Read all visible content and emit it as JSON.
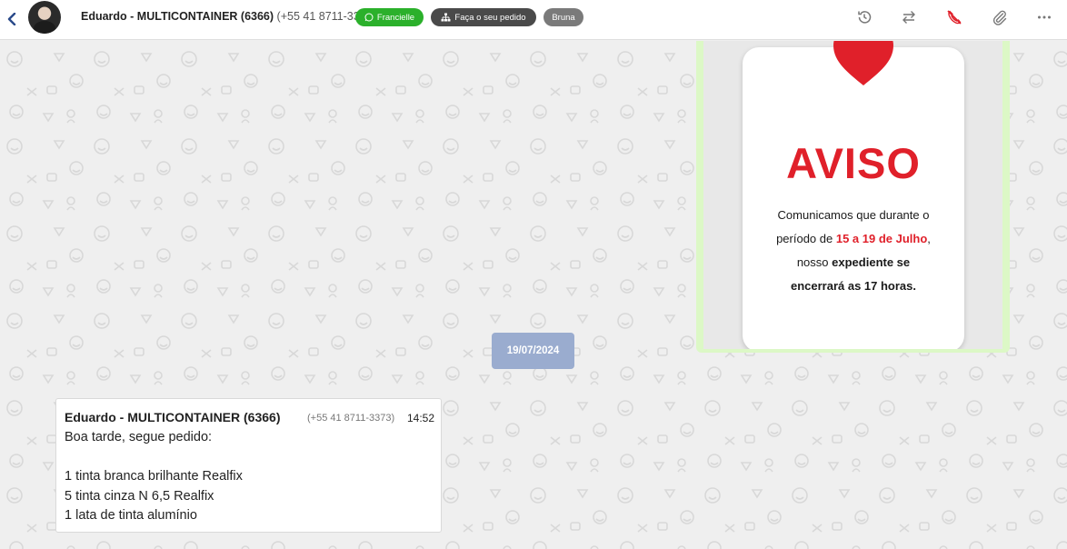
{
  "header": {
    "contact_name": "Eduardo - MULTICONTAINER (6366)",
    "contact_phone": "(+55 41 8711-3373)",
    "tags": {
      "agent": "Francielle",
      "order": "Faça o seu pedido",
      "user": "Bruna"
    },
    "colors": {
      "agent_tag": "#2bb02b",
      "order_tag": "#4a4a4a",
      "user_tag": "#7a7a7a",
      "call_icon": "#e0202a"
    },
    "icons": [
      "back-icon",
      "history-icon",
      "transfer-icon",
      "end-call-icon",
      "attachment-icon",
      "more-options-icon"
    ]
  },
  "image_message": {
    "title": "AVISO",
    "line1": "Comunicamos que durante o",
    "line2_prefix": "período de",
    "line2_dates": "15 a 19 de Julho",
    "line2_suffix": ",",
    "line3_prefix": "nosso",
    "line3_bold": "expediente se",
    "line4": "encerrará as 17 horas."
  },
  "date_separator": "19/07/2024",
  "message": {
    "sender": "Eduardo - MULTICONTAINER (6366)",
    "phone": "(+55 41 8711-3373)",
    "time": "14:52",
    "body": "Boa tarde, segue pedido:\n\n1 tinta branca brilhante Realfix\n5 tinta cinza N 6,5 Realfix\n1 lata de tinta alumínio"
  }
}
